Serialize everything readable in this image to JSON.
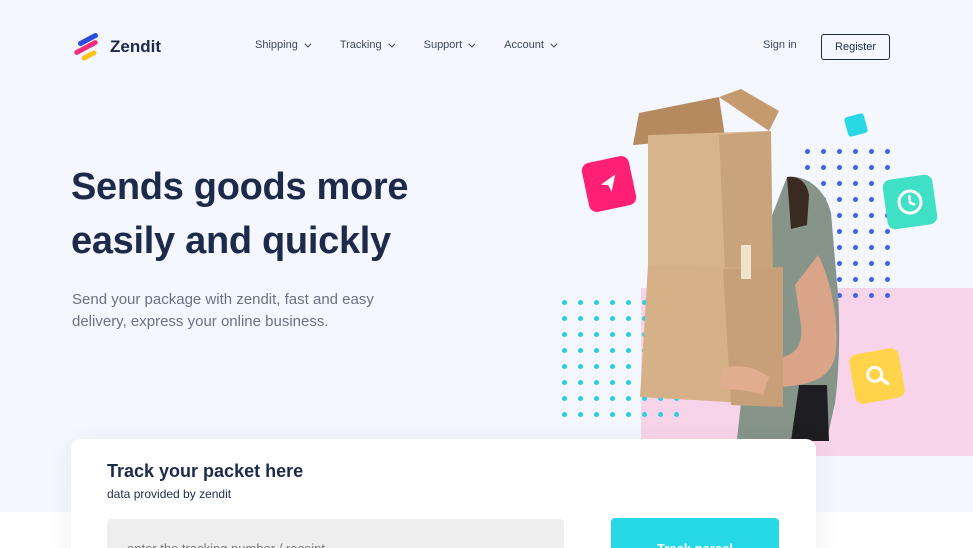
{
  "brand": {
    "name": "Zendit"
  },
  "nav": {
    "items": [
      {
        "label": "Shipping"
      },
      {
        "label": "Tracking"
      },
      {
        "label": "Support"
      },
      {
        "label": "Account"
      }
    ],
    "signin_label": "Sign in",
    "register_label": "Register"
  },
  "hero": {
    "title": "Sends goods more easily and quickly",
    "subtitle": "Send your package with zendit, fast and easy delivery, express your online business."
  },
  "illustration": {
    "icons": [
      "send-icon",
      "clock-icon",
      "search-icon"
    ],
    "colors": {
      "pink": "#ff1f74",
      "teal": "#3fe0c5",
      "cyan": "#28d8e4",
      "yellow": "#ffd44a",
      "blue_dots": "#3f62e8",
      "cyan_dots": "#28d0e0",
      "pink_block": "#f8d4ea"
    }
  },
  "tracking": {
    "title": "Track your packet here",
    "subtitle": "data provided by zendit",
    "input_placeholder": "enter the tracking number / receipt",
    "button_label": "Track parcel"
  },
  "colors": {
    "navy": "#1d2a4a",
    "accent": "#27d8e6",
    "background": "#f4f7fd"
  }
}
